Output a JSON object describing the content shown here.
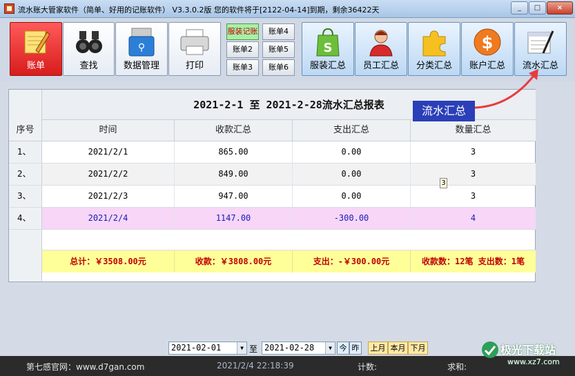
{
  "window": {
    "title": "流水账大管家软件（简单、好用的记账软件） V3.3.0.2版 您的软件将于[2122-04-14]到期，剩余36422天",
    "controls": [
      "_",
      "□",
      "×"
    ]
  },
  "toolbar": {
    "main_tools": [
      {
        "label": "账单",
        "icon": "notepad-pencil-icon"
      },
      {
        "label": "查找",
        "icon": "binoculars-icon"
      },
      {
        "label": "数据管理",
        "icon": "usb-drive-icon"
      },
      {
        "label": "打印",
        "icon": "printer-icon"
      }
    ],
    "ledger_buttons": [
      "服装记账",
      "账单4",
      "账单2",
      "账单5",
      "账单3",
      "账单6"
    ],
    "summary_tools": [
      {
        "label": "服装汇总",
        "icon": "shopping-bag-icon"
      },
      {
        "label": "员工汇总",
        "icon": "employee-icon"
      },
      {
        "label": "分类汇总",
        "icon": "puzzle-piece-icon"
      },
      {
        "label": "账户汇总",
        "icon": "dollar-coin-icon"
      },
      {
        "label": "流水汇总",
        "icon": "report-pen-icon"
      }
    ]
  },
  "report": {
    "title": "2021-2-1  至  2021-2-28流水汇总报表",
    "columns": [
      "序号",
      "时间",
      "收款汇总",
      "支出汇总",
      "数量汇总"
    ],
    "rows": [
      {
        "idx": "1、",
        "date": "2021/2/1",
        "income": "865.00",
        "expense": "0.00",
        "qty": "3"
      },
      {
        "idx": "2、",
        "date": "2021/2/2",
        "income": "849.00",
        "expense": "0.00",
        "qty": "3"
      },
      {
        "idx": "3、",
        "date": "2021/2/3",
        "income": "947.00",
        "expense": "0.00",
        "qty": "3"
      },
      {
        "idx": "4、",
        "date": "2021/2/4",
        "income": "1147.00",
        "expense": "-300.00",
        "qty": "4"
      }
    ],
    "summary": {
      "total": "总计：￥3508.00元",
      "income": "收款：￥3808.00元",
      "expense": "支出：-￥300.00元",
      "counts": "收款数：12笔   支出数：1笔"
    },
    "tooltip_value": "3"
  },
  "callout": {
    "text": "流水汇总",
    "arrow_color": "#e83c3c"
  },
  "filter": {
    "start_date": "2021-02-01",
    "to_label": "至",
    "end_date": "2021-02-28",
    "today_label": "今",
    "yesterday_label": "昨",
    "last_month_label": "上月",
    "this_month_label": "本月",
    "next_month_label": "下月"
  },
  "status": {
    "site": "第七感官网：www.d7gan.com",
    "datetime": "2021/2/4 22:18:39",
    "count_label": "计数:",
    "sum_label": "求和:"
  },
  "watermark": {
    "text": "极光下载站",
    "url": "www.xz7.com"
  },
  "colors": {
    "accent_red": "#d81c1c",
    "summary_bg": "#ffff99",
    "highlight_row": "#f7d6f7",
    "callout_bg": "#2a3fb8"
  }
}
